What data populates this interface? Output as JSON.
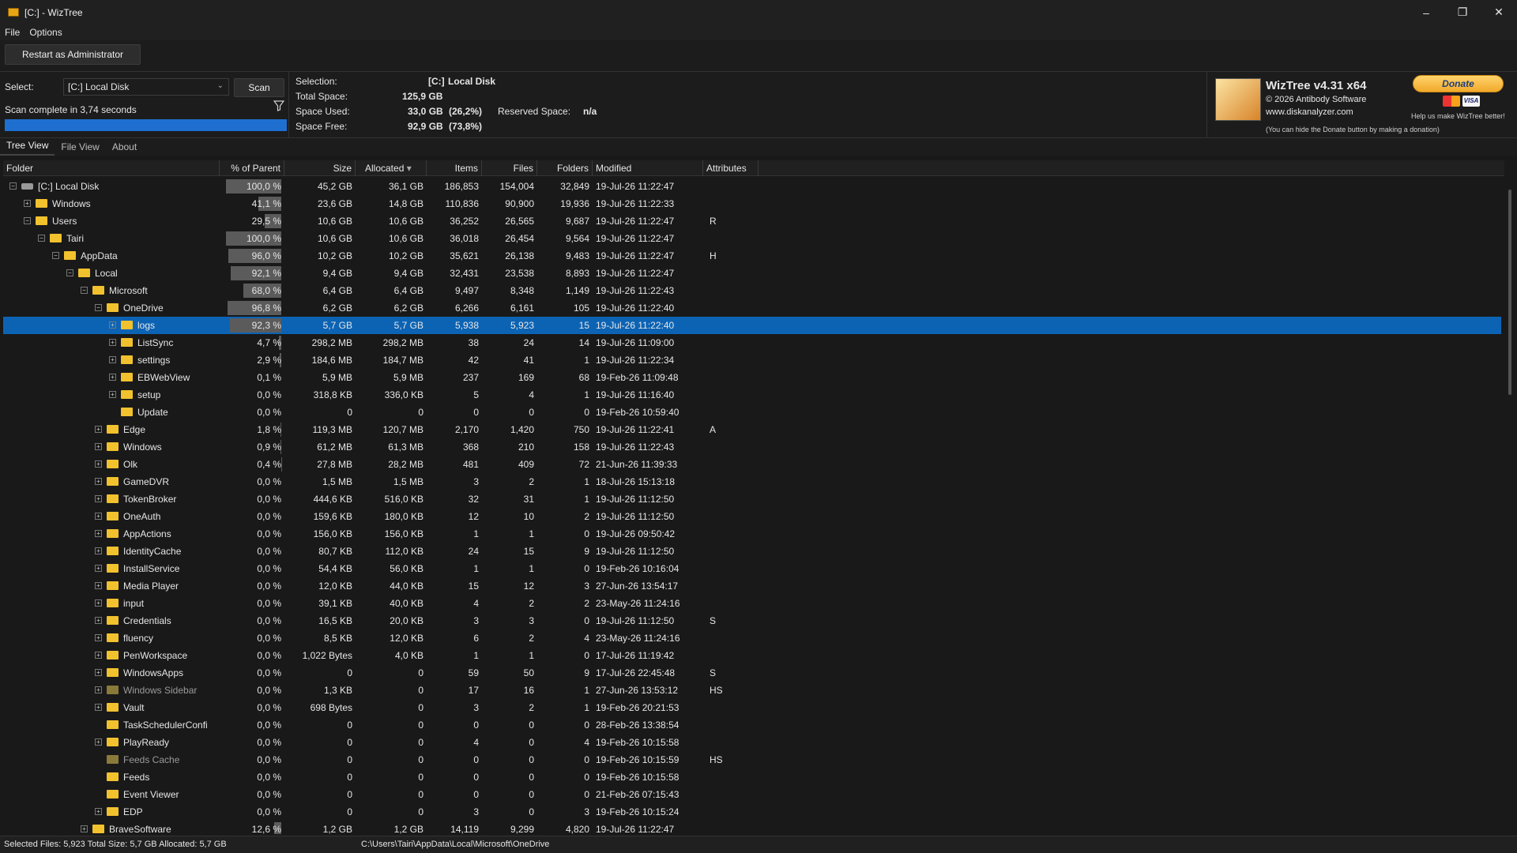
{
  "window": {
    "title": "[C:]  - WizTree",
    "controls": [
      "–",
      "❐",
      "✕"
    ]
  },
  "menu": [
    "File",
    "Options"
  ],
  "toolbar": {
    "restart_label": "Restart as Administrator"
  },
  "select": {
    "label": "Select:",
    "drive": "[C:] Local Disk",
    "scan_label": "Scan",
    "scan_status": "Scan complete in 3,74 seconds",
    "progress_fraction": 1.0
  },
  "selection_info": {
    "selection_label": "Selection:",
    "selection_drive": "[C:]",
    "selection_name": "Local Disk",
    "total_label": "Total Space:",
    "total_value": "125,9 GB",
    "used_label": "Space Used:",
    "used_value": "33,0 GB",
    "used_pct": "(26,2%)",
    "reserved_label": "Reserved Space:",
    "reserved_value": "n/a",
    "free_label": "Space Free:",
    "free_value": "92,9 GB",
    "free_pct": "(73,8%)"
  },
  "about_box": {
    "title": "WizTree v4.31 x64",
    "copyright": "© 2026 Antibody Software",
    "website": "www.diskanalyzer.com",
    "donate_label": "Donate",
    "help_text": "Help us make WizTree better!",
    "hide_note": "(You can hide the Donate button by making a donation)",
    "card_visa": "VISA"
  },
  "tabs": [
    "Tree View",
    "File View",
    "About"
  ],
  "columns": [
    "Folder",
    "% of Parent",
    "Size",
    "Allocated",
    "Items",
    "Files",
    "Folders",
    "Modified",
    "Attributes"
  ],
  "sort_indicator": "▾",
  "rows": [
    {
      "name": "[C:] Local Disk",
      "pct": "100,0 %",
      "pct_value": 100.0,
      "size": "45,2 GB",
      "alloc": "36,1 GB",
      "items": "186,853",
      "files": "154,004",
      "folders": "32,849",
      "modified": "19-Jul-26 11:22:47",
      "attr": "",
      "exp": "−"
    },
    {
      "name": "Windows",
      "pct": "41,1 %",
      "pct_value": 41.1,
      "size": "23,6 GB",
      "alloc": "14,8 GB",
      "items": "110,836",
      "files": "90,900",
      "folders": "19,936",
      "modified": "19-Jul-26 11:22:33",
      "attr": "",
      "exp": "+"
    },
    {
      "name": "Users",
      "pct": "29,5 %",
      "pct_value": 29.5,
      "size": "10,6 GB",
      "alloc": "10,6 GB",
      "items": "36,252",
      "files": "26,565",
      "folders": "9,687",
      "modified": "19-Jul-26 11:22:47",
      "attr": "R",
      "exp": "−"
    },
    {
      "name": "Tairi",
      "pct": "100,0 %",
      "pct_value": 100.0,
      "size": "10,6 GB",
      "alloc": "10,6 GB",
      "items": "36,018",
      "files": "26,454",
      "folders": "9,564",
      "modified": "19-Jul-26 11:22:47",
      "attr": "",
      "exp": "−"
    },
    {
      "name": "AppData",
      "pct": "96,0 %",
      "pct_value": 96.0,
      "size": "10,2 GB",
      "alloc": "10,2 GB",
      "items": "35,621",
      "files": "26,138",
      "folders": "9,483",
      "modified": "19-Jul-26 11:22:47",
      "attr": "H",
      "exp": "−"
    },
    {
      "name": "Local",
      "pct": "92,1 %",
      "pct_value": 92.1,
      "size": "9,4 GB",
      "alloc": "9,4 GB",
      "items": "32,431",
      "files": "23,538",
      "folders": "8,893",
      "modified": "19-Jul-26 11:22:47",
      "attr": "",
      "exp": "−"
    },
    {
      "name": "Microsoft",
      "pct": "68,0 %",
      "pct_value": 68.0,
      "size": "6,4 GB",
      "alloc": "6,4 GB",
      "items": "9,497",
      "files": "8,348",
      "folders": "1,149",
      "modified": "19-Jul-26 11:22:43",
      "attr": "",
      "exp": "−"
    },
    {
      "name": "OneDrive",
      "pct": "96,8 %",
      "pct_value": 96.8,
      "size": "6,2 GB",
      "alloc": "6,2 GB",
      "items": "6,266",
      "files": "6,161",
      "folders": "105",
      "modified": "19-Jul-26 11:22:40",
      "attr": "",
      "exp": "−"
    },
    {
      "name": "logs",
      "pct": "92,3 %",
      "pct_value": 92.3,
      "size": "5,7 GB",
      "alloc": "5,7 GB",
      "items": "5,938",
      "files": "5,923",
      "folders": "15",
      "modified": "19-Jul-26 11:22:40",
      "attr": "",
      "exp": "+"
    },
    {
      "name": "ListSync",
      "pct": "4,7 %",
      "pct_value": 4.7,
      "size": "298,2 MB",
      "alloc": "298,2 MB",
      "items": "38",
      "files": "24",
      "folders": "14",
      "modified": "19-Jul-26 11:09:00",
      "attr": "",
      "exp": "+"
    },
    {
      "name": "settings",
      "pct": "2,9 %",
      "pct_value": 2.9,
      "size": "184,6 MB",
      "alloc": "184,7 MB",
      "items": "42",
      "files": "41",
      "folders": "1",
      "modified": "19-Jul-26 11:22:34",
      "attr": "",
      "exp": "+"
    },
    {
      "name": "EBWebView",
      "pct": "0,1 %",
      "pct_value": 0.1,
      "size": "5,9 MB",
      "alloc": "5,9 MB",
      "items": "237",
      "files": "169",
      "folders": "68",
      "modified": "19-Feb-26 11:09:48",
      "attr": "",
      "exp": "+"
    },
    {
      "name": "setup",
      "pct": "0,0 %",
      "pct_value": 0.0,
      "size": "318,8 KB",
      "alloc": "336,0 KB",
      "items": "5",
      "files": "4",
      "folders": "1",
      "modified": "19-Jul-26 11:16:40",
      "attr": "",
      "exp": "+"
    },
    {
      "name": "Update",
      "pct": "0,0 %",
      "pct_value": 0.0,
      "size": "0",
      "alloc": "0",
      "items": "0",
      "files": "0",
      "folders": "0",
      "modified": "19-Feb-26 10:59:40",
      "attr": "",
      "exp": ""
    },
    {
      "name": "Edge",
      "pct": "1,8 %",
      "pct_value": 1.8,
      "size": "119,3 MB",
      "alloc": "120,7 MB",
      "items": "2,170",
      "files": "1,420",
      "folders": "750",
      "modified": "19-Jul-26 11:22:41",
      "attr": "A",
      "exp": "+"
    },
    {
      "name": "Windows",
      "pct": "0,9 %",
      "pct_value": 0.9,
      "size": "61,2 MB",
      "alloc": "61,3 MB",
      "items": "368",
      "files": "210",
      "folders": "158",
      "modified": "19-Jul-26 11:22:43",
      "attr": "",
      "exp": "+"
    },
    {
      "name": "Olk",
      "pct": "0,4 %",
      "pct_value": 0.4,
      "size": "27,8 MB",
      "alloc": "28,2 MB",
      "items": "481",
      "files": "409",
      "folders": "72",
      "modified": "21-Jun-26 11:39:33",
      "attr": "",
      "exp": "+"
    },
    {
      "name": "GameDVR",
      "pct": "0,0 %",
      "pct_value": 0.0,
      "size": "1,5 MB",
      "alloc": "1,5 MB",
      "items": "3",
      "files": "2",
      "folders": "1",
      "modified": "18-Jul-26 15:13:18",
      "attr": "",
      "exp": "+"
    },
    {
      "name": "TokenBroker",
      "pct": "0,0 %",
      "pct_value": 0.0,
      "size": "444,6 KB",
      "alloc": "516,0 KB",
      "items": "32",
      "files": "31",
      "folders": "1",
      "modified": "19-Jul-26 11:12:50",
      "attr": "",
      "exp": "+"
    },
    {
      "name": "OneAuth",
      "pct": "0,0 %",
      "pct_value": 0.0,
      "size": "159,6 KB",
      "alloc": "180,0 KB",
      "items": "12",
      "files": "10",
      "folders": "2",
      "modified": "19-Jul-26 11:12:50",
      "attr": "",
      "exp": "+"
    },
    {
      "name": "AppActions",
      "pct": "0,0 %",
      "pct_value": 0.0,
      "size": "156,0 KB",
      "alloc": "156,0 KB",
      "items": "1",
      "files": "1",
      "folders": "0",
      "modified": "19-Jul-26 09:50:42",
      "attr": "",
      "exp": "+"
    },
    {
      "name": "IdentityCache",
      "pct": "0,0 %",
      "pct_value": 0.0,
      "size": "80,7 KB",
      "alloc": "112,0 KB",
      "items": "24",
      "files": "15",
      "folders": "9",
      "modified": "19-Jul-26 11:12:50",
      "attr": "",
      "exp": "+"
    },
    {
      "name": "InstallService",
      "pct": "0,0 %",
      "pct_value": 0.0,
      "size": "54,4 KB",
      "alloc": "56,0 KB",
      "items": "1",
      "files": "1",
      "folders": "0",
      "modified": "19-Feb-26 10:16:04",
      "attr": "",
      "exp": "+"
    },
    {
      "name": "Media Player",
      "pct": "0,0 %",
      "pct_value": 0.0,
      "size": "12,0 KB",
      "alloc": "44,0 KB",
      "items": "15",
      "files": "12",
      "folders": "3",
      "modified": "27-Jun-26 13:54:17",
      "attr": "",
      "exp": "+"
    },
    {
      "name": "input",
      "pct": "0,0 %",
      "pct_value": 0.0,
      "size": "39,1 KB",
      "alloc": "40,0 KB",
      "items": "4",
      "files": "2",
      "folders": "2",
      "modified": "23-May-26 11:24:16",
      "attr": "",
      "exp": "+"
    },
    {
      "name": "Credentials",
      "pct": "0,0 %",
      "pct_value": 0.0,
      "size": "16,5 KB",
      "alloc": "20,0 KB",
      "items": "3",
      "files": "3",
      "folders": "0",
      "modified": "19-Jul-26 11:12:50",
      "attr": "S",
      "exp": "+"
    },
    {
      "name": "fluency",
      "pct": "0,0 %",
      "pct_value": 0.0,
      "size": "8,5 KB",
      "alloc": "12,0 KB",
      "items": "6",
      "files": "2",
      "folders": "4",
      "modified": "23-May-26 11:24:16",
      "attr": "",
      "exp": "+"
    },
    {
      "name": "PenWorkspace",
      "pct": "0,0 %",
      "pct_value": 0.0,
      "size": "1,022 Bytes",
      "alloc": "4,0 KB",
      "items": "1",
      "files": "1",
      "folders": "0",
      "modified": "17-Jul-26 11:19:42",
      "attr": "",
      "exp": "+"
    },
    {
      "name": "WindowsApps",
      "pct": "0,0 %",
      "pct_value": 0.0,
      "size": "0",
      "alloc": "0",
      "items": "59",
      "files": "50",
      "folders": "9",
      "modified": "17-Jul-26 22:45:48",
      "attr": "S",
      "exp": "+"
    },
    {
      "name": "Windows Sidebar",
      "pct": "0,0 %",
      "pct_value": 0.0,
      "size": "1,3 KB",
      "alloc": "0",
      "items": "17",
      "files": "16",
      "folders": "1",
      "modified": "27-Jun-26 13:53:12",
      "attr": "HS",
      "exp": "+",
      "dim": true
    },
    {
      "name": "Vault",
      "pct": "0,0 %",
      "pct_value": 0.0,
      "size": "698 Bytes",
      "alloc": "0",
      "items": "3",
      "files": "2",
      "folders": "1",
      "modified": "19-Feb-26 20:21:53",
      "attr": "",
      "exp": "+"
    },
    {
      "name": "TaskSchedulerConfi",
      "pct": "0,0 %",
      "pct_value": 0.0,
      "size": "0",
      "alloc": "0",
      "items": "0",
      "files": "0",
      "folders": "0",
      "modified": "28-Feb-26 13:38:54",
      "attr": "",
      "exp": ""
    },
    {
      "name": "PlayReady",
      "pct": "0,0 %",
      "pct_value": 0.0,
      "size": "0",
      "alloc": "0",
      "items": "4",
      "files": "0",
      "folders": "4",
      "modified": "19-Feb-26 10:15:58",
      "attr": "",
      "exp": "+"
    },
    {
      "name": "Feeds Cache",
      "pct": "0,0 %",
      "pct_value": 0.0,
      "size": "0",
      "alloc": "0",
      "items": "0",
      "files": "0",
      "folders": "0",
      "modified": "19-Feb-26 10:15:59",
      "attr": "HS",
      "exp": "",
      "dim": true
    },
    {
      "name": "Feeds",
      "pct": "0,0 %",
      "pct_value": 0.0,
      "size": "0",
      "alloc": "0",
      "items": "0",
      "files": "0",
      "folders": "0",
      "modified": "19-Feb-26 10:15:58",
      "attr": "",
      "exp": ""
    },
    {
      "name": "Event Viewer",
      "pct": "0,0 %",
      "pct_value": 0.0,
      "size": "0",
      "alloc": "0",
      "items": "0",
      "files": "0",
      "folders": "0",
      "modified": "21-Feb-26 07:15:43",
      "attr": "",
      "exp": ""
    },
    {
      "name": "EDP",
      "pct": "0,0 %",
      "pct_value": 0.0,
      "size": "0",
      "alloc": "0",
      "items": "3",
      "files": "0",
      "folders": "3",
      "modified": "19-Feb-26 10:15:24",
      "attr": "",
      "exp": "+"
    },
    {
      "name": "BraveSoftware",
      "pct": "12,6 %",
      "pct_value": 12.6,
      "size": "1,2 GB",
      "alloc": "1,2 GB",
      "items": "14,119",
      "files": "9,299",
      "folders": "4,820",
      "modified": "19-Jul-26 11:22:47",
      "attr": "",
      "exp": "+"
    }
  ],
  "status": {
    "selected": "Selected Files: 5,923  Total Size: 5,7 GB  Allocated: 5,7 GB",
    "path": "C:\\Users\\Tairi\\AppData\\Local\\Microsoft\\OneDrive"
  },
  "colors": {
    "accent": "#1e6fcf",
    "selected_row": "#0c63b4",
    "folder": "#f2c12e",
    "background": "#191919"
  }
}
